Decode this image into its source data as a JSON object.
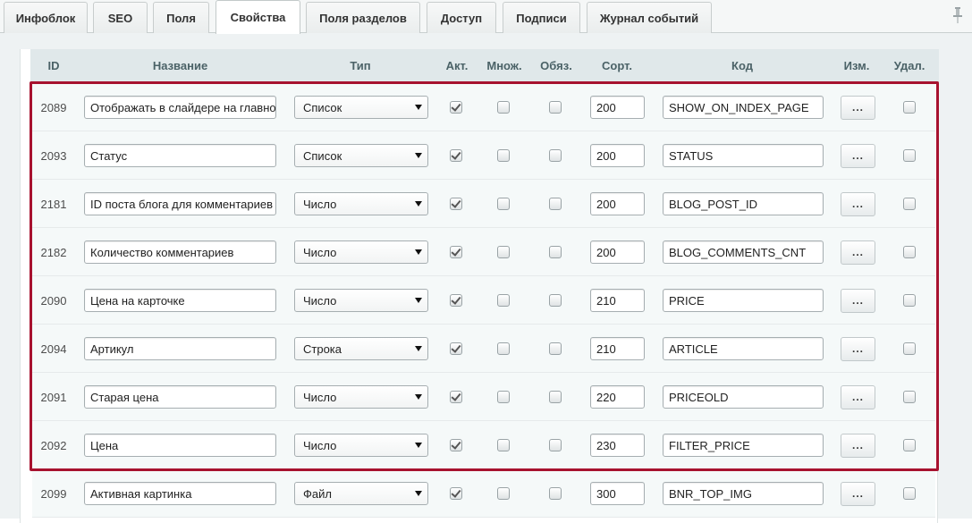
{
  "tabs": [
    {
      "label": "Инфоблок",
      "active": false
    },
    {
      "label": "SEO",
      "active": false
    },
    {
      "label": "Поля",
      "active": false
    },
    {
      "label": "Свойства",
      "active": true
    },
    {
      "label": "Поля разделов",
      "active": false
    },
    {
      "label": "Доступ",
      "active": false
    },
    {
      "label": "Подписи",
      "active": false
    },
    {
      "label": "Журнал событий",
      "active": false
    }
  ],
  "columns": {
    "id": "ID",
    "name": "Название",
    "type": "Тип",
    "active": "Акт.",
    "multiple": "Множ.",
    "required": "Обяз.",
    "sort": "Сорт.",
    "code": "Код",
    "edit": "Изм.",
    "delete": "Удал."
  },
  "edit_button_label": "...",
  "highlight_color": "#a7122f",
  "rows": [
    {
      "id": "2089",
      "name": "Отображать в слайдере на главной",
      "type": "Список",
      "active": true,
      "multiple": false,
      "required": false,
      "sort": "200",
      "code": "SHOW_ON_INDEX_PAGE",
      "delete": false
    },
    {
      "id": "2093",
      "name": "Статус",
      "type": "Список",
      "active": true,
      "multiple": false,
      "required": false,
      "sort": "200",
      "code": "STATUS",
      "delete": false
    },
    {
      "id": "2181",
      "name": "ID поста блога для комментариев",
      "type": "Число",
      "active": true,
      "multiple": false,
      "required": false,
      "sort": "200",
      "code": "BLOG_POST_ID",
      "delete": false
    },
    {
      "id": "2182",
      "name": "Количество комментариев",
      "type": "Число",
      "active": true,
      "multiple": false,
      "required": false,
      "sort": "200",
      "code": "BLOG_COMMENTS_CNT",
      "delete": false
    },
    {
      "id": "2090",
      "name": "Цена на карточке",
      "type": "Число",
      "active": true,
      "multiple": false,
      "required": false,
      "sort": "210",
      "code": "PRICE",
      "delete": false
    },
    {
      "id": "2094",
      "name": "Артикул",
      "type": "Строка",
      "active": true,
      "multiple": false,
      "required": false,
      "sort": "210",
      "code": "ARTICLE",
      "delete": false
    },
    {
      "id": "2091",
      "name": "Старая цена",
      "type": "Число",
      "active": true,
      "multiple": false,
      "required": false,
      "sort": "220",
      "code": "PRICEOLD",
      "delete": false
    },
    {
      "id": "2092",
      "name": "Цена",
      "type": "Число",
      "active": true,
      "multiple": false,
      "required": false,
      "sort": "230",
      "code": "FILTER_PRICE",
      "delete": false
    },
    {
      "id": "2099",
      "name": "Активная картинка",
      "type": "Файл",
      "active": true,
      "multiple": false,
      "required": false,
      "sort": "300",
      "code": "BNR_TOP_IMG",
      "delete": false
    }
  ]
}
